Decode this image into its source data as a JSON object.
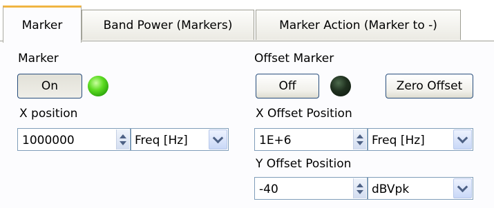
{
  "tabs": [
    {
      "label": "Marker",
      "active": true
    },
    {
      "label": "Band Power (Markers)",
      "active": false
    },
    {
      "label": "Marker Action (Marker to -)",
      "active": false
    }
  ],
  "marker": {
    "section_label": "Marker",
    "toggle_label": "On",
    "led_state": "on",
    "x_position_label": "X position",
    "x_position_value": "1000000",
    "x_unit": "Freq [Hz]"
  },
  "offset_marker": {
    "section_label": "Offset Marker",
    "toggle_label": "Off",
    "led_state": "off",
    "zero_offset_label": "Zero Offset",
    "x_offset_label": "X Offset Position",
    "x_offset_value": "1E+6",
    "x_offset_unit": "Freq [Hz]",
    "y_offset_label": "Y Offset Position",
    "y_offset_value": "-40",
    "y_offset_unit": "dBVpk"
  },
  "colors": {
    "active_tab_accent": "#f0b542",
    "led_on": "#5ddc22",
    "led_off": "#1f301f"
  }
}
